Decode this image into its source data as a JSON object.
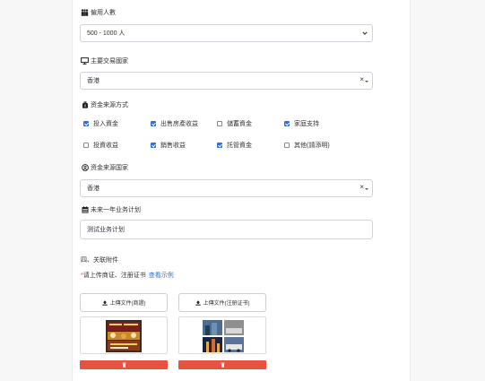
{
  "form": {
    "employees": {
      "label": "僱用人數",
      "value": "500 - 1000 人"
    },
    "trade_country": {
      "label": "主要交易國家",
      "value": "香港",
      "clear": "×"
    },
    "fund_source": {
      "label": "资金来源方式",
      "options": [
        {
          "label": "投入資金",
          "checked": true
        },
        {
          "label": "出售房產收益",
          "checked": true
        },
        {
          "label": "儲蓄資金",
          "checked": false
        },
        {
          "label": "家庭支持",
          "checked": true
        },
        {
          "label": "投資收益",
          "checked": false
        },
        {
          "label": "銷售收益",
          "checked": true
        },
        {
          "label": "託管資金",
          "checked": true
        },
        {
          "label": "其他(請添明)",
          "checked": false
        }
      ]
    },
    "fund_country": {
      "label": "资金来源国家",
      "value": "香港",
      "clear": "×"
    },
    "business_plan": {
      "label": "未来一年业务计划",
      "value": "测试业务计划"
    }
  },
  "attachments": {
    "section_title": "四、关联附件",
    "required_mark": "*",
    "note": "请上传商证、注册证书",
    "example_link": "查看示例",
    "upload_1": "上傳文件(商證)",
    "upload_2": "上傳文件(注册证书)",
    "delete_color": "#e9523e"
  },
  "colors": {
    "accent": "#2f6fd8",
    "danger": "#e9523e",
    "link": "#2f6fd8"
  }
}
